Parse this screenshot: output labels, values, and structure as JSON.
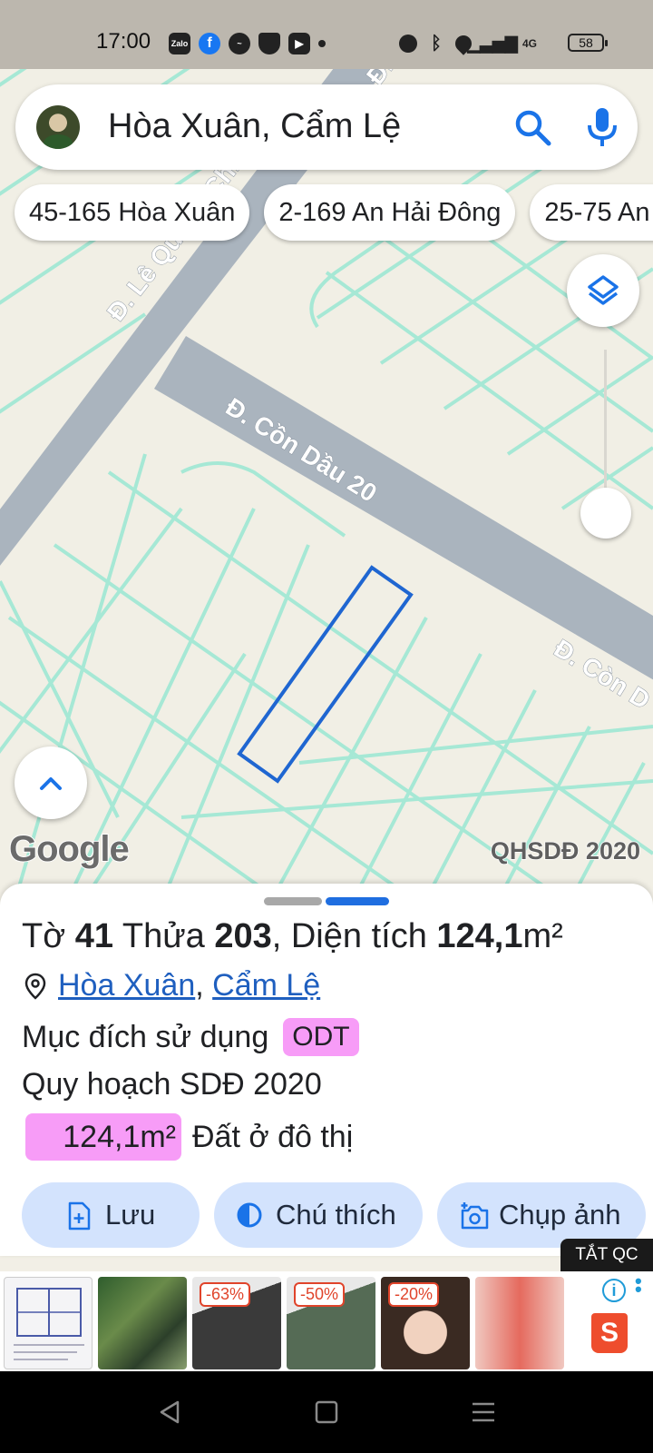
{
  "status_bar": {
    "time": "17:00",
    "battery": "58",
    "network": "4G"
  },
  "search": {
    "query": "Hòa Xuân, Cẩm Lệ"
  },
  "chips": [
    "45-165 Hòa Xuân",
    "2-169 An Hải Đông",
    "25-75 An"
  ],
  "map": {
    "roads": [
      "Đ. Lê Quảng Chí",
      "Đ. Cồn Dầu 20",
      "Đ. Còn D",
      "Đ. Lê Q"
    ],
    "logo": "Google",
    "overlay_label": "QHSDĐ 2020",
    "colors": {
      "background": "#f1efe5",
      "road": "#aab4be",
      "parcel_lines": "#a6e8d5",
      "selected_parcel": "#1f66d1"
    }
  },
  "parcel": {
    "sheet_label": "Tờ",
    "sheet_number": "41",
    "lot_label": "Thửa",
    "lot_number": "203",
    "area_label": ", Diện tích",
    "area_value": "124,1",
    "area_unit": "m²",
    "ward": "Hòa Xuân",
    "separator": ",",
    "district": "Cẩm Lệ",
    "purpose_label": "Mục đích sử dụng",
    "purpose_code": "ODT",
    "plan_label": "Quy hoạch SDĐ 2020",
    "plan_area": "124,1m²",
    "plan_type": "Đất ở đô thị",
    "badge_color": "#f79cf7"
  },
  "actions": {
    "save": "Lưu",
    "legend": "Chú thích",
    "screenshot": "Chụp ảnh"
  },
  "ads": {
    "close_label": "TẮT QC",
    "discounts": [
      "-63%",
      "-50%",
      "-20%"
    ],
    "shop_letter": "S"
  }
}
